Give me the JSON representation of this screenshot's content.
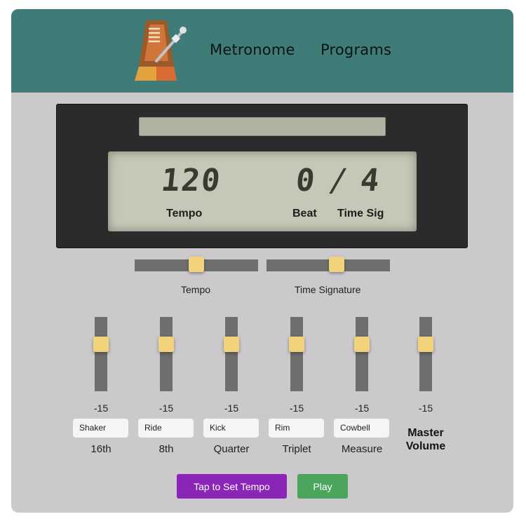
{
  "header": {
    "logo": "metronome-icon",
    "nav": [
      "Metronome",
      "Programs"
    ]
  },
  "display": {
    "tempo_value": "120",
    "beat_value": "0",
    "slash": "/",
    "timesig_value": "4",
    "tempo_label": "Tempo",
    "beat_label": "Beat",
    "timesig_label": "Time Sig"
  },
  "sliders": {
    "tempo": {
      "label": "Tempo",
      "position": 0.5
    },
    "timesig": {
      "label": "Time Signature",
      "position": 0.58
    }
  },
  "channels": [
    {
      "label": "16th",
      "sound": "Shaker",
      "volume": "-15",
      "level": 0.67
    },
    {
      "label": "8th",
      "sound": "Ride",
      "volume": "-15",
      "level": 0.67
    },
    {
      "label": "Quarter",
      "sound": "Kick",
      "volume": "-15",
      "level": 0.67
    },
    {
      "label": "Triplet",
      "sound": "Rim",
      "volume": "-15",
      "level": 0.67
    },
    {
      "label": "Measure",
      "sound": "Cowbell",
      "volume": "-15",
      "level": 0.67
    }
  ],
  "master": {
    "label_line1": "Master",
    "label_line2": "Volume",
    "volume": "-15",
    "level": 0.67
  },
  "buttons": {
    "tap": "Tap to Set Tempo",
    "play": "Play"
  },
  "colors": {
    "header": "#3f7c78",
    "panel": "#cbc9cb",
    "thumb": "#f2d27a",
    "track": "#6e6e6e",
    "lcd": "#c6c7b6",
    "tap_button": "#8a25b6",
    "play_button": "#4aa45c"
  }
}
